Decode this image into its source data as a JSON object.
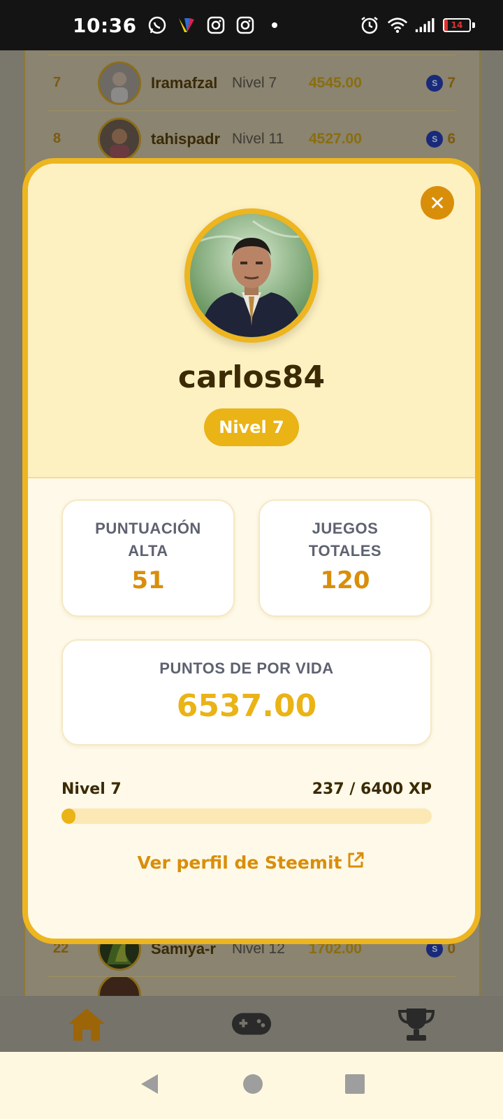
{
  "status_bar": {
    "time": "10:36",
    "left_icons": [
      "whatsapp-icon",
      "colorful-app-icon",
      "instagram-icon",
      "instagram-icon",
      "dot-icon"
    ],
    "right_icons": [
      "alarm-icon",
      "wifi-icon",
      "signal-icon"
    ],
    "battery_percent": "14",
    "battery_color": "#e23030"
  },
  "leaderboard_bg": {
    "rows": [
      {
        "rank": "7",
        "name": "Iramafzal",
        "level": "Nivel 7",
        "points": "4545.00",
        "coins": "7"
      },
      {
        "rank": "8",
        "name": "tahispadr",
        "level": "Nivel 11",
        "points": "4527.00",
        "coins": "6"
      },
      {
        "rank": "22",
        "name": "Samiya-r",
        "level": "Nivel 12",
        "points": "1702.00",
        "coins": "0"
      }
    ]
  },
  "profile_modal": {
    "username": "carlos84",
    "level_badge": "Nivel 7",
    "high_score": {
      "label_line1": "PUNTUACIÓN",
      "label_line2": "ALTA",
      "value": "51"
    },
    "total_games": {
      "label_line1": "JUEGOS",
      "label_line2": "TOTALES",
      "value": "120"
    },
    "lifetime_points": {
      "label": "PUNTOS DE POR VIDA",
      "value": "6537.00"
    },
    "xp": {
      "level_label": "Nivel 7",
      "progress_text": "237 / 6400 XP",
      "current": 237,
      "max": 6400
    },
    "steemit_link": "Ver perfil de Steemit",
    "close_icon": "close-icon"
  },
  "bottom_nav": {
    "items": [
      "home-icon",
      "gamepad-icon",
      "trophy-icon"
    ],
    "active": "home-icon"
  },
  "colors": {
    "accent": "#edb520",
    "accent_dark": "#d98e0a",
    "text_dark": "#3b2a04",
    "label_gray": "#5e6270"
  }
}
